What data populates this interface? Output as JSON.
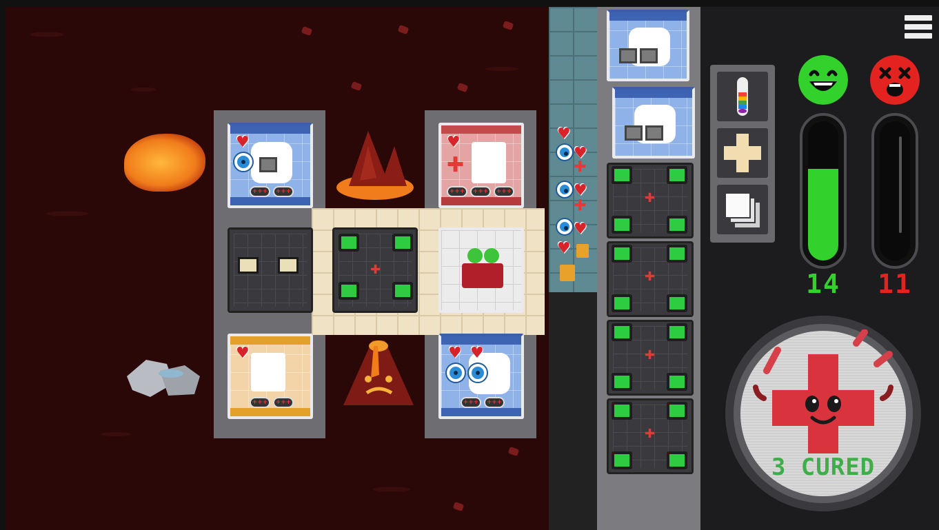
{
  "hud": {
    "menu_icon": "hamburger-menu-icon",
    "tools": [
      {
        "name": "potion-tool",
        "icon": "rainbow-test-tube-icon"
      },
      {
        "name": "build-room-tool",
        "icon": "plus-cross-icon"
      },
      {
        "name": "copy-tool",
        "icon": "stacked-squares-icon"
      }
    ],
    "cured_meter": {
      "icon": "happy-green-face-icon",
      "value": "14",
      "fill_fraction": 0.66,
      "color": "#33d12b"
    },
    "dead_meter": {
      "icon": "dead-red-face-icon",
      "value": "11",
      "fill_fraction": 0.0,
      "color": "#e3231f"
    },
    "cure_button": {
      "icon": "red-cross-mascot-icon",
      "label": "3 CURED"
    }
  },
  "colors": {
    "lava": "#2a0808",
    "corridor": "#efe2c5",
    "room_blue": "#8fb3e8",
    "room_red": "#e5a4a4",
    "room_orange": "#f3d4a8"
  }
}
